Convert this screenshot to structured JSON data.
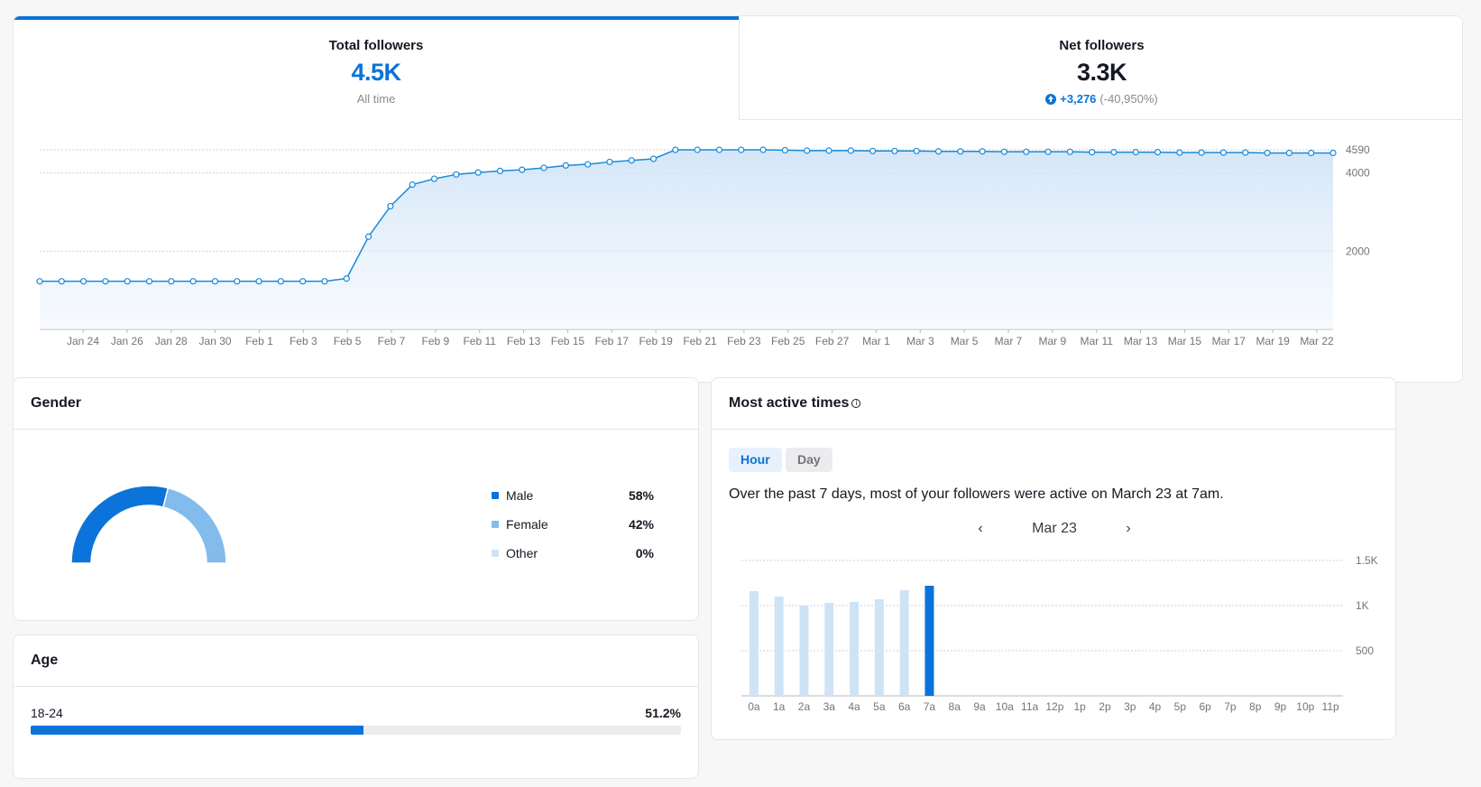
{
  "tabs": {
    "total": {
      "label": "Total followers",
      "value": "4.5K",
      "sub": "All time"
    },
    "net": {
      "label": "Net followers",
      "value": "3.3K",
      "delta": "+3,276",
      "delta_pct": "(-40,950%)"
    }
  },
  "followers_chart": {
    "type": "line",
    "x_labels": [
      "Jan 24",
      "Jan 26",
      "Jan 28",
      "Jan 30",
      "Feb 1",
      "Feb 3",
      "Feb 5",
      "Feb 7",
      "Feb 9",
      "Feb 11",
      "Feb 13",
      "Feb 15",
      "Feb 17",
      "Feb 19",
      "Feb 21",
      "Feb 23",
      "Feb 25",
      "Feb 27",
      "Mar 1",
      "Mar 3",
      "Mar 5",
      "Mar 7",
      "Mar 9",
      "Mar 11",
      "Mar 13",
      "Mar 15",
      "Mar 17",
      "Mar 19",
      "Mar 22"
    ],
    "y_ticks": [
      2000,
      4000,
      4590
    ],
    "values": [
      1230,
      1230,
      1230,
      1230,
      1230,
      1230,
      1230,
      1230,
      1230,
      1230,
      1230,
      1230,
      1230,
      1230,
      1300,
      2370,
      3150,
      3700,
      3850,
      3960,
      4010,
      4050,
      4080,
      4130,
      4190,
      4220,
      4280,
      4320,
      4360,
      4590,
      4590,
      4590,
      4590,
      4590,
      4580,
      4570,
      4570,
      4570,
      4560,
      4560,
      4560,
      4550,
      4550,
      4550,
      4540,
      4540,
      4540,
      4540,
      4530,
      4530,
      4530,
      4530,
      4520,
      4520,
      4520,
      4520,
      4510,
      4510,
      4510,
      4510
    ],
    "ylim": [
      0,
      4590
    ],
    "line_color": "#1a8ad8"
  },
  "gender": {
    "title": "Gender",
    "items": [
      {
        "label": "Male",
        "pct": "58%",
        "value": 58,
        "color": "#0b73d9"
      },
      {
        "label": "Female",
        "pct": "42%",
        "value": 42,
        "color": "#82bbec"
      },
      {
        "label": "Other",
        "pct": "0%",
        "value": 0,
        "color": "#cfe3f7"
      }
    ]
  },
  "age": {
    "title": "Age",
    "rows": [
      {
        "label": "18-24",
        "pct": "51.2%",
        "value": 51.2
      }
    ]
  },
  "active": {
    "title": "Most active times",
    "buttons": {
      "hour": "Hour",
      "day": "Day"
    },
    "summary": "Over the past 7 days, most of your followers were active on March 23 at 7am.",
    "date": "Mar 23",
    "chart": {
      "type": "bar",
      "categories": [
        "0a",
        "1a",
        "2a",
        "3a",
        "4a",
        "5a",
        "6a",
        "7a",
        "8a",
        "9a",
        "10a",
        "11a",
        "12p",
        "1p",
        "2p",
        "3p",
        "4p",
        "5p",
        "6p",
        "7p",
        "8p",
        "9p",
        "10p",
        "11p"
      ],
      "values": [
        1160,
        1100,
        1000,
        1030,
        1040,
        1070,
        1170,
        1220,
        null,
        null,
        null,
        null,
        null,
        null,
        null,
        null,
        null,
        null,
        null,
        null,
        null,
        null,
        null,
        null
      ],
      "highlight_index": 7,
      "y_ticks": [
        "500",
        "1K",
        "1.5K"
      ],
      "ylim": [
        0,
        1500
      ],
      "bar_color": "#cfe3f7",
      "highlight_color": "#0b73d9"
    }
  }
}
